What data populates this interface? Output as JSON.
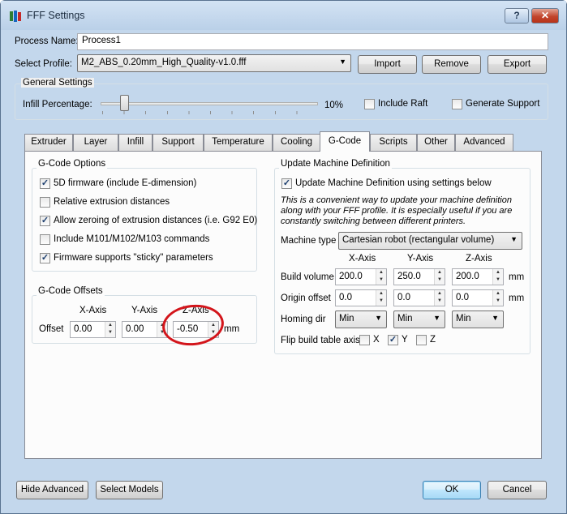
{
  "window": {
    "title": "FFF Settings",
    "help_label": "?",
    "close_label": "✕"
  },
  "process": {
    "name_label": "Process Name:",
    "name_value": "Process1"
  },
  "profile": {
    "label": "Select Profile:",
    "value": "M2_ABS_0.20mm_High_Quality-v1.0.fff",
    "import_label": "Import",
    "remove_label": "Remove",
    "export_label": "Export"
  },
  "general": {
    "title": "General Settings",
    "infill_label": "Infill Percentage:",
    "infill_value": "10%",
    "infill_percent": 10,
    "include_raft_label": "Include Raft",
    "include_raft_checked": false,
    "generate_support_label": "Generate Support",
    "generate_support_checked": false
  },
  "tabs": [
    "Extruder",
    "Layer",
    "Infill",
    "Support",
    "Temperature",
    "Cooling",
    "G-Code",
    "Scripts",
    "Other",
    "Advanced"
  ],
  "active_tab": "G-Code",
  "gcode_options": {
    "title": "G-Code Options",
    "items": [
      {
        "label": "5D firmware (include E-dimension)",
        "checked": true
      },
      {
        "label": "Relative extrusion distances",
        "checked": false
      },
      {
        "label": "Allow zeroing of extrusion distances (i.e. G92 E0)",
        "checked": true
      },
      {
        "label": "Include M101/M102/M103 commands",
        "checked": false
      },
      {
        "label": "Firmware supports \"sticky\" parameters",
        "checked": true
      }
    ]
  },
  "gcode_offsets": {
    "title": "G-Code Offsets",
    "x_header": "X-Axis",
    "y_header": "Y-Axis",
    "z_header": "Z-Axis",
    "row_label": "Offset",
    "x_value": "0.00",
    "y_value": "0.00",
    "z_value": "-0.50",
    "unit": "mm"
  },
  "machine": {
    "title": "Update Machine Definition",
    "update_label": "Update Machine Definition using settings below",
    "update_checked": true,
    "note": "This is a convenient way to update your machine definition along with your FFF profile.  It is especially useful if you are constantly switching between different printers.",
    "type_label": "Machine type",
    "type_value": "Cartesian robot (rectangular volume)",
    "x_header": "X-Axis",
    "y_header": "Y-Axis",
    "z_header": "Z-Axis",
    "build_label": "Build volume",
    "build": [
      "200.0",
      "250.0",
      "200.0"
    ],
    "origin_label": "Origin offset",
    "origin": [
      "0.0",
      "0.0",
      "0.0"
    ],
    "unit": "mm",
    "homing_label": "Homing dir",
    "homing": [
      "Min",
      "Min",
      "Min"
    ],
    "flip_label": "Flip build table axis",
    "flip_x_label": "X",
    "flip_x_checked": false,
    "flip_y_label": "Y",
    "flip_y_checked": true,
    "flip_z_label": "Z",
    "flip_z_checked": false
  },
  "footer": {
    "hide_advanced_label": "Hide Advanced",
    "select_models_label": "Select Models",
    "ok_label": "OK",
    "cancel_label": "Cancel"
  },
  "annotation_color": "#d3151b"
}
